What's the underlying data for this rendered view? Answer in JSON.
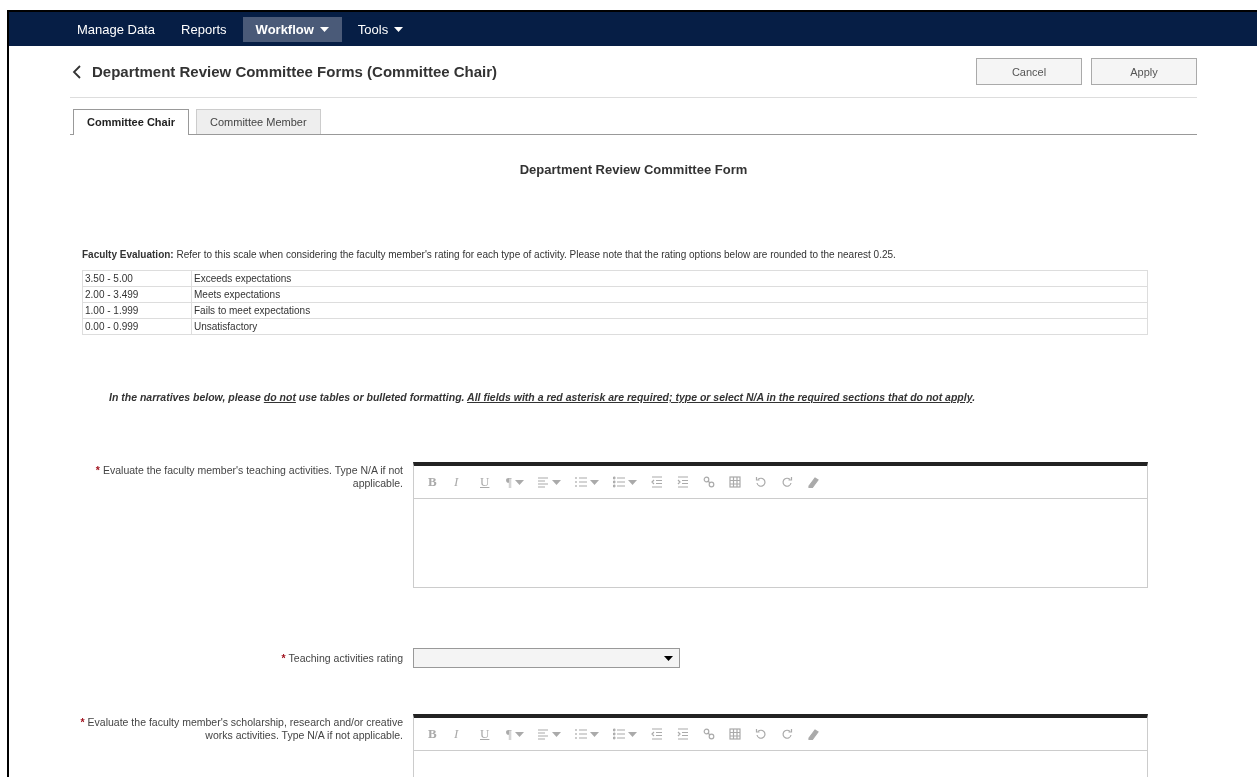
{
  "nav": [
    {
      "label": "Manage Data",
      "selected": false,
      "has_menu": false
    },
    {
      "label": "Reports",
      "selected": false,
      "has_menu": false
    },
    {
      "label": "Workflow",
      "selected": true,
      "has_menu": true
    },
    {
      "label": "Tools",
      "selected": false,
      "has_menu": true
    }
  ],
  "page": {
    "title": "Department Review Committee Forms (Committee Chair)",
    "buttons": [
      "Cancel",
      "Apply"
    ]
  },
  "tabs": [
    {
      "label": "Committee Chair",
      "selected": true
    },
    {
      "label": "Committee Member",
      "selected": false
    }
  ],
  "form": {
    "title": "Department Review Committee Form",
    "scale_intro": "**Faculty Evaluation:**  Refer to this scale when considering the faculty member's rating for each type of activity. Please note that the rating options below are rounded to the nearest 0.25.",
    "scale": [
      {
        "range": "3.50 - 5.00",
        "meaning": "Exceeds expectations"
      },
      {
        "range": "2.00 - 3.499",
        "meaning": "Meets expectations"
      },
      {
        "range": "1.00 - 1.999",
        "meaning": "Fails to meet expectations"
      },
      {
        "range": "0.00 - 0.999",
        "meaning": "Unsatisfactory"
      }
    ],
    "instructions": [
      {
        "text": "In the narratives below, please ",
        "underline": false
      },
      {
        "text": "do not",
        "underline": true
      },
      {
        "text": " use tables or bulleted formatting.  ",
        "underline": false
      },
      {
        "text": "All fields with a red asterisk are required; type or select N/A in the required sections that do not apply",
        "underline": true
      },
      {
        "text": ".",
        "underline": false
      }
    ],
    "fields": [
      {
        "kind": "editor",
        "asterisk": "*",
        "label": "Evaluate the faculty member's teaching activities. Type N/A if not applicable.",
        "toolbar": {
          "bold": "B",
          "italic": "I",
          "underline": "U",
          "paragraph": "¶"
        }
      },
      {
        "kind": "select",
        "asterisk": "*",
        "label": "Teaching activities rating"
      },
      {
        "kind": "editor",
        "asterisk": "*",
        "label": "Evaluate the faculty member's scholarship, research and/or creative works activities. Type N/A if not applicable.",
        "toolbar": {
          "bold": "B",
          "italic": "I",
          "underline": "U",
          "paragraph": "¶"
        }
      }
    ]
  }
}
